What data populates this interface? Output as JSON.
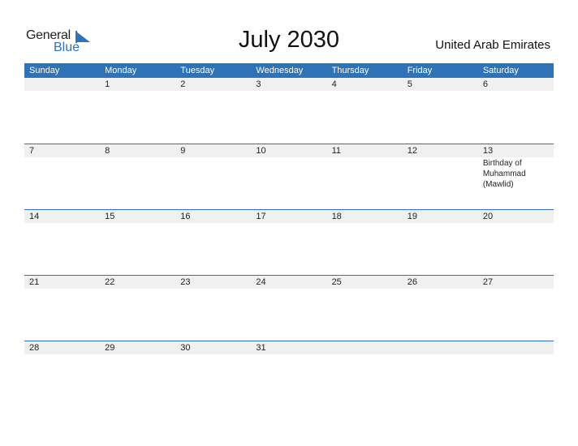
{
  "logo": {
    "word1": "General",
    "word2": "Blue"
  },
  "title": "July 2030",
  "country": "United Arab Emirates",
  "colors": {
    "accent": "#2f72b6",
    "row_bg": "#f0f0f0"
  },
  "weekdays": [
    "Sunday",
    "Monday",
    "Tuesday",
    "Wednesday",
    "Thursday",
    "Friday",
    "Saturday"
  ],
  "weeks": [
    {
      "days": [
        "",
        "1",
        "2",
        "3",
        "4",
        "5",
        "6"
      ],
      "events": [
        "",
        "",
        "",
        "",
        "",
        "",
        ""
      ]
    },
    {
      "days": [
        "7",
        "8",
        "9",
        "10",
        "11",
        "12",
        "13"
      ],
      "events": [
        "",
        "",
        "",
        "",
        "",
        "",
        "Birthday of Muhammad (Mawlid)"
      ]
    },
    {
      "days": [
        "14",
        "15",
        "16",
        "17",
        "18",
        "19",
        "20"
      ],
      "events": [
        "",
        "",
        "",
        "",
        "",
        "",
        ""
      ]
    },
    {
      "days": [
        "21",
        "22",
        "23",
        "24",
        "25",
        "26",
        "27"
      ],
      "events": [
        "",
        "",
        "",
        "",
        "",
        "",
        ""
      ]
    },
    {
      "days": [
        "28",
        "29",
        "30",
        "31",
        "",
        "",
        ""
      ],
      "events": [
        "",
        "",
        "",
        "",
        "",
        "",
        ""
      ]
    }
  ]
}
